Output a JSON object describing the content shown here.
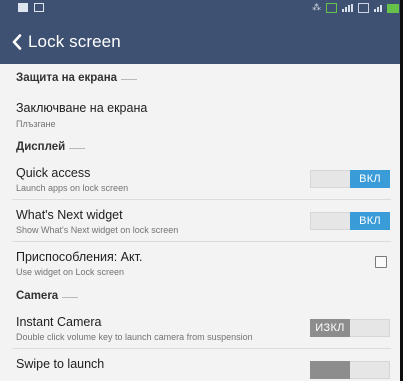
{
  "toolbar": {
    "title": "Lock screen"
  },
  "sections": [
    {
      "header": "Защита на екрана",
      "rows": [
        {
          "title": "Заключване на екрана",
          "summary": "Плъзгане",
          "control": "none"
        }
      ]
    },
    {
      "header": "Дисплей",
      "rows": [
        {
          "title": "Quick access",
          "summary": "Launch apps on lock screen",
          "control": "toggle",
          "state": "on",
          "toggle_label": "ВКЛ"
        },
        {
          "title": "What's Next widget",
          "summary": "Show What's Next widget on lock screen",
          "control": "toggle",
          "state": "on",
          "toggle_label": "ВКЛ"
        },
        {
          "title": "Приспособления: Акт.",
          "summary": "Use widget on Lock screen",
          "control": "checkbox",
          "checked": false
        }
      ]
    },
    {
      "header": "Camera",
      "rows": [
        {
          "title": "Instant Camera",
          "summary": "Double click volume key to launch camera from suspension",
          "control": "toggle",
          "state": "off",
          "toggle_label": "ИЗКЛ"
        },
        {
          "title": "Swipe to launch",
          "summary": "",
          "control": "toggle",
          "state": "off",
          "toggle_label": ""
        }
      ]
    }
  ],
  "colors": {
    "toolbar": "#3e5172",
    "toggle_on": "#3a9bd9",
    "toggle_off": "#8d8d8d",
    "background": "#f3f3f3"
  },
  "icons": {
    "back": "chevron-left-icon"
  }
}
